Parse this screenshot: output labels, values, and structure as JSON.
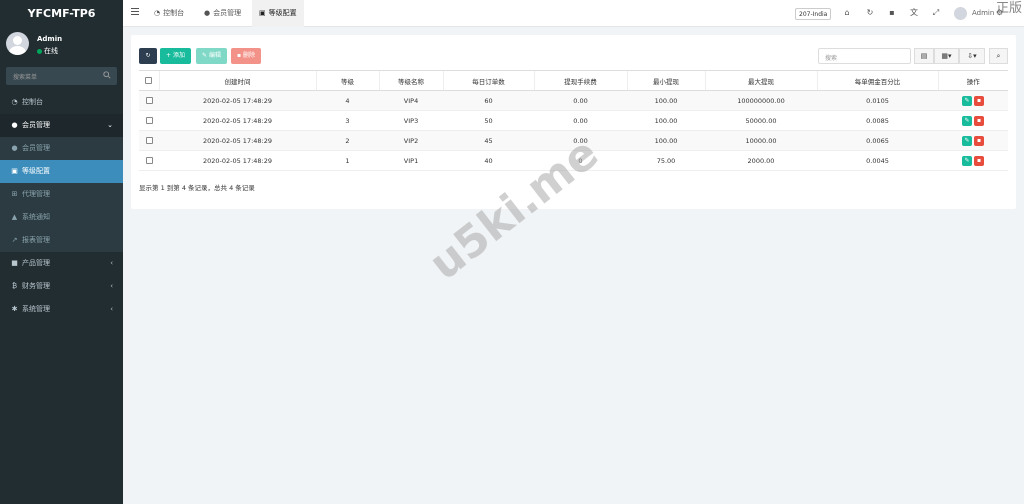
{
  "app": {
    "brand": "YFCMF-TP6"
  },
  "user": {
    "name": "Admin",
    "status": "在线"
  },
  "sidebar": {
    "search_placeholder": "搜索菜单",
    "items": [
      {
        "label": "控制台",
        "icon": "dashboard-icon"
      },
      {
        "label": "会员管理",
        "icon": "user-icon"
      },
      {
        "label": "会员管理",
        "icon": "user-icon"
      },
      {
        "label": "等级配置",
        "icon": "level-icon"
      },
      {
        "label": "代理管理",
        "icon": "sitemap-icon"
      },
      {
        "label": "系统通知",
        "icon": "bell-icon"
      },
      {
        "label": "报表管理",
        "icon": "chart-icon"
      },
      {
        "label": "产品管理",
        "icon": "product-icon"
      },
      {
        "label": "财务管理",
        "icon": "bitcoin-icon"
      },
      {
        "label": "系统管理",
        "icon": "gears-icon"
      }
    ]
  },
  "topbar": {
    "tabs": [
      {
        "label": "控制台"
      },
      {
        "label": "会员管理"
      },
      {
        "label": "等级配置"
      }
    ],
    "region": "207-India",
    "user": "Admin",
    "corner_text": "正版"
  },
  "toolbar": {
    "add_label": "添加",
    "edit_label": "编辑",
    "delete_label": "删除",
    "search_placeholder": "搜索"
  },
  "table": {
    "columns": [
      "创建时间",
      "等级",
      "等级名称",
      "每日订单数",
      "提现手续费",
      "最小提现",
      "最大提现",
      "每单佣金百分比",
      "操作"
    ],
    "rows": [
      [
        "2020-02-05 17:48:29",
        "4",
        "VIP4",
        "60",
        "0.00",
        "100.00",
        "100000000.00",
        "0.0105"
      ],
      [
        "2020-02-05 17:48:29",
        "3",
        "VIP3",
        "50",
        "0.00",
        "100.00",
        "50000.00",
        "0.0085"
      ],
      [
        "2020-02-05 17:48:29",
        "2",
        "VIP2",
        "45",
        "0.00",
        "100.00",
        "10000.00",
        "0.0065"
      ],
      [
        "2020-02-05 17:48:29",
        "1",
        "VIP1",
        "40",
        "0",
        "75.00",
        "2000.00",
        "0.0045"
      ]
    ],
    "summary": "显示第 1 到第 4 条记录，总共 4 条记录"
  },
  "watermark": "u5ki.me"
}
